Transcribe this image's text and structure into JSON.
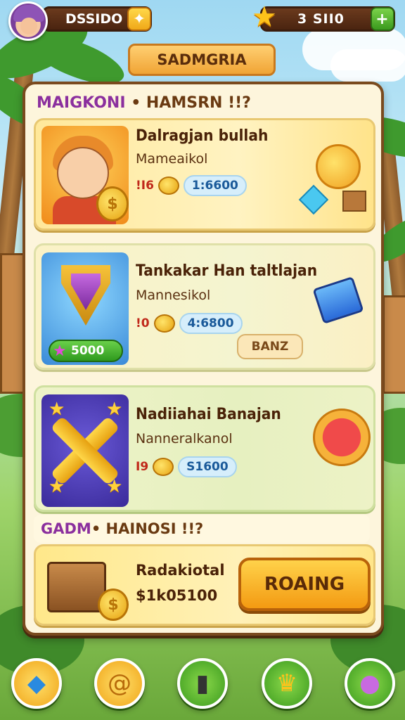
{
  "topbar": {
    "currency_left": "DSSIDO",
    "currency_right": "3  SII0",
    "add_symbol": "+",
    "star_symbol": "★"
  },
  "header": {
    "title": "SADMGRIA"
  },
  "section1": {
    "accent": "MAIGKONI",
    "text": " • HAMSRN !!?"
  },
  "cards": [
    {
      "title": "Dalragjan bullah",
      "subtitle": "Mameaikol",
      "level": "!I6",
      "price": "1:6600"
    },
    {
      "title": "Tankakar Han taltlajan",
      "subtitle": "Mannesikol",
      "level": "!0",
      "price": "4:6800",
      "gem_value": "5000",
      "badge": "BANZ"
    },
    {
      "title": "Nadiiahai Banajan",
      "subtitle": "Nanneralkanol",
      "level": "I9",
      "price": "S1600"
    }
  ],
  "section2": {
    "accent": "GADM",
    "text": " • HAINOSI !!?"
  },
  "offer": {
    "title": "Radakiotal",
    "price": "$1k05100",
    "button": "ROAING"
  },
  "nav": [
    {
      "icon": "crystal-icon",
      "color": "#3aa0f0"
    },
    {
      "icon": "coin-swirl-icon",
      "color": "#f5b82a"
    },
    {
      "icon": "phone-icon",
      "color": "#4ab03a"
    },
    {
      "icon": "trophy-icon",
      "color": "#4ab03a"
    },
    {
      "icon": "orb-icon",
      "color": "#4ab03a"
    }
  ]
}
